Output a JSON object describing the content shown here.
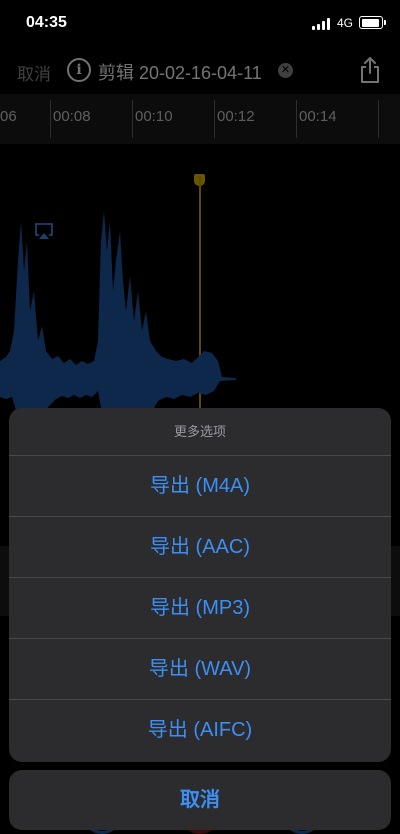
{
  "status": {
    "time": "04:35",
    "network": "4G"
  },
  "header": {
    "cancel_label": "取消",
    "title": "剪辑 20-02-16-04-11"
  },
  "ruler": {
    "labels": [
      "06",
      "00:08",
      "00:10",
      "00:12",
      "00:14"
    ]
  },
  "sheet": {
    "title": "更多选项",
    "items": [
      "导出 (M4A)",
      "导出 (AAC)",
      "导出 (MP3)",
      "导出 (WAV)",
      "导出 (AIFC)"
    ],
    "cancel_label": "取消"
  },
  "colors": {
    "accent": "#3c8ff5",
    "playhead": "#c9a800",
    "waveform": "#1e5aa5",
    "sheet_bg": "#2c2c2e"
  }
}
